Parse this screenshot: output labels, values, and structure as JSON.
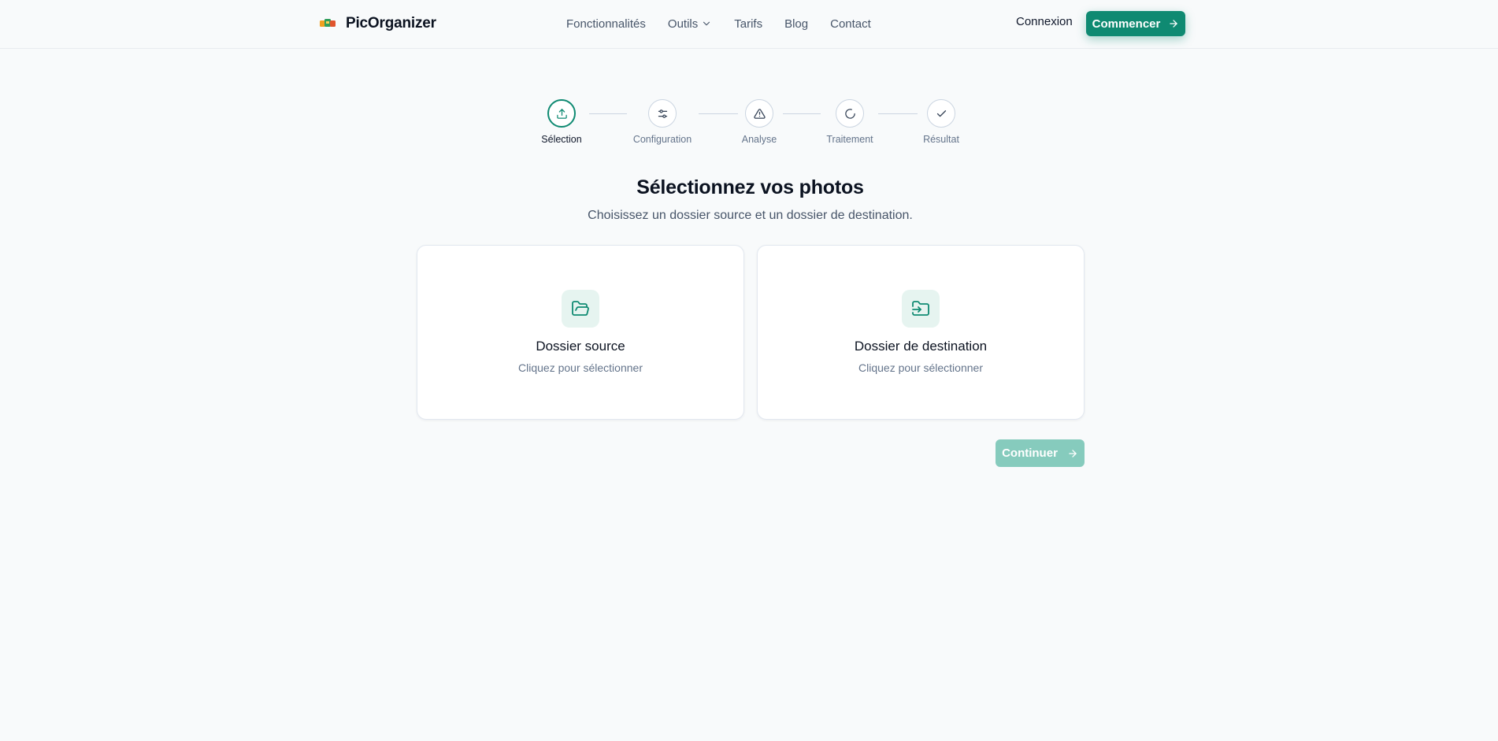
{
  "header": {
    "brand": "PicOrganizer",
    "nav": [
      "Fonctionnalités",
      "Outils",
      "Tarifs",
      "Blog",
      "Contact"
    ],
    "login": "Connexion",
    "cta": "Commencer"
  },
  "stepper": {
    "steps": [
      "Sélection",
      "Configuration",
      "Analyse",
      "Traitement",
      "Résultat"
    ],
    "current": 1
  },
  "main": {
    "title": "Sélectionnez vos photos",
    "subtitle": "Choisissez un dossier source et un dossier de destination.",
    "source": {
      "title": "Dossier source",
      "hint": "Cliquez pour sélectionner"
    },
    "destination": {
      "title": "Dossier de destination",
      "hint": "Cliquez pour sélectionner"
    },
    "continue": "Continuer"
  },
  "colors": {
    "accent": "#0f8a72",
    "accent_disabled": "#86cbbd",
    "icon_bg": "#e6f4f0"
  }
}
